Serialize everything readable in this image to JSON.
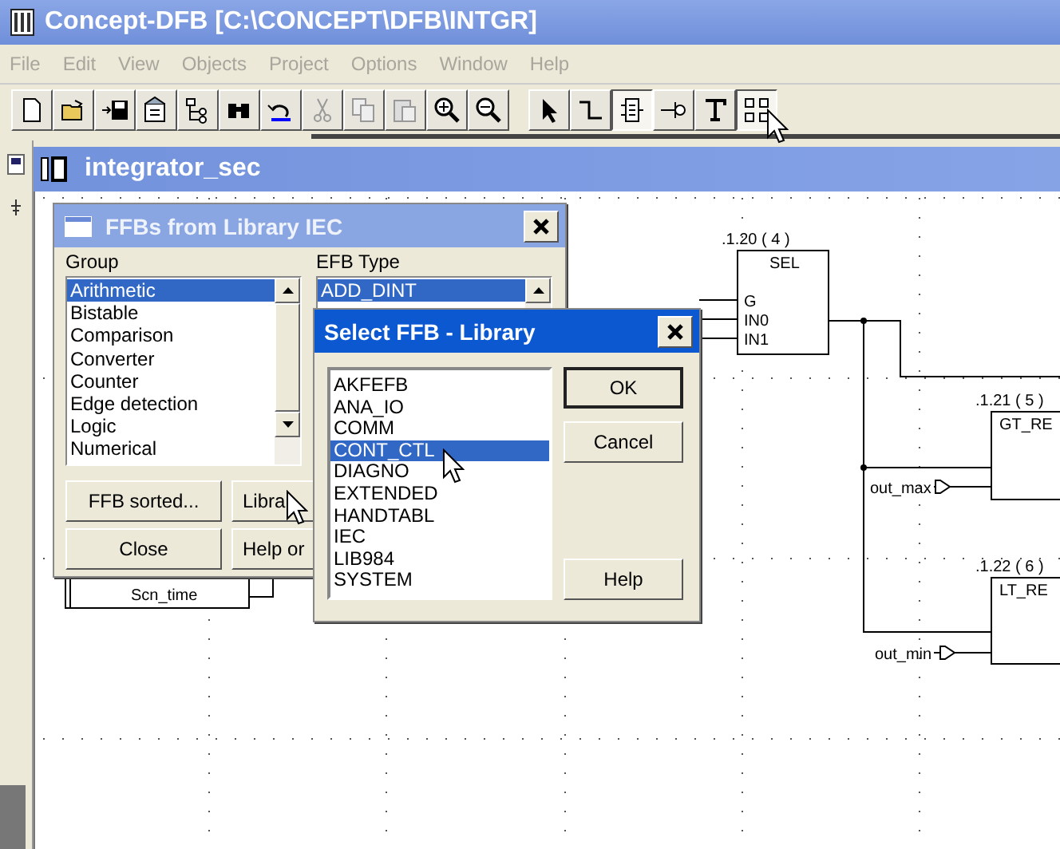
{
  "window": {
    "title": "Concept-DFB [C:\\CONCEPT\\DFB\\INTGR]"
  },
  "menu": [
    {
      "label": "File",
      "disabled": true
    },
    {
      "label": "Edit",
      "disabled": true
    },
    {
      "label": "View",
      "disabled": true
    },
    {
      "label": "Objects",
      "disabled": true
    },
    {
      "label": "Project",
      "disabled": true
    },
    {
      "label": "Options",
      "disabled": true
    },
    {
      "label": "Window",
      "disabled": true
    },
    {
      "label": "Help",
      "disabled": true
    }
  ],
  "toolbar": [
    {
      "pressed": false
    },
    {
      "pressed": false
    },
    {
      "pressed": false
    },
    {
      "pressed": false
    },
    {
      "pressed": false
    },
    {
      "pressed": false
    },
    {
      "pressed": false
    },
    {
      "pressed": false
    },
    {
      "pressed": false
    },
    {
      "pressed": false
    },
    {
      "pressed": false
    },
    {
      "pressed": false
    },
    {
      "pressed": false
    },
    {
      "pressed": false
    },
    {
      "pressed": true
    },
    {
      "pressed": false
    },
    {
      "pressed": false
    },
    {
      "pressed": true
    }
  ],
  "section": {
    "title": "integrator_sec"
  },
  "diagram": {
    "blocks": [
      {
        "label": ".1.20 ( 4 )",
        "type": "SEL",
        "pins": [
          "G",
          "IN0",
          "IN1"
        ]
      },
      {
        "label": ".1.21 ( 5 )",
        "type": "GT_RE"
      },
      {
        "label": ".1.22 ( 6 )",
        "type": "LT_RE"
      }
    ],
    "variables": [
      {
        "name": "out_max"
      },
      {
        "name": "out_min"
      },
      {
        "name": "Scn_time"
      }
    ]
  },
  "ffb_dialog": {
    "title": "FFBs from Library IEC",
    "group_label": "Group",
    "efb_label": "EFB Type",
    "groups": [
      {
        "label": "Arithmetic",
        "selected": true
      },
      {
        "label": "Bistable",
        "selected": false
      },
      {
        "label": "Comparison",
        "selected": false
      },
      {
        "label": "Converter",
        "selected": false
      },
      {
        "label": "Counter",
        "selected": false
      },
      {
        "label": "Edge detection",
        "selected": false
      },
      {
        "label": "Logic",
        "selected": false
      },
      {
        "label": "Numerical",
        "selected": false
      }
    ],
    "efb_types": [
      {
        "label": "ADD_DINT",
        "selected": true
      }
    ],
    "buttons": [
      "FFB sorted...",
      "Libra",
      "Close",
      "Help or"
    ]
  },
  "library_dialog": {
    "title": "Select FFB - Library",
    "libraries": [
      {
        "label": "AKFEFB",
        "selected": false
      },
      {
        "label": "ANA_IO",
        "selected": false
      },
      {
        "label": "COMM",
        "selected": false
      },
      {
        "label": "CONT_CTL",
        "selected": true
      },
      {
        "label": "DIAGNO",
        "selected": false
      },
      {
        "label": "EXTENDED",
        "selected": false
      },
      {
        "label": "HANDTABL",
        "selected": false
      },
      {
        "label": "IEC",
        "selected": false
      },
      {
        "label": "LIB984",
        "selected": false
      },
      {
        "label": "SYSTEM",
        "selected": false
      }
    ],
    "buttons": [
      "OK",
      "Cancel",
      "Help"
    ]
  }
}
